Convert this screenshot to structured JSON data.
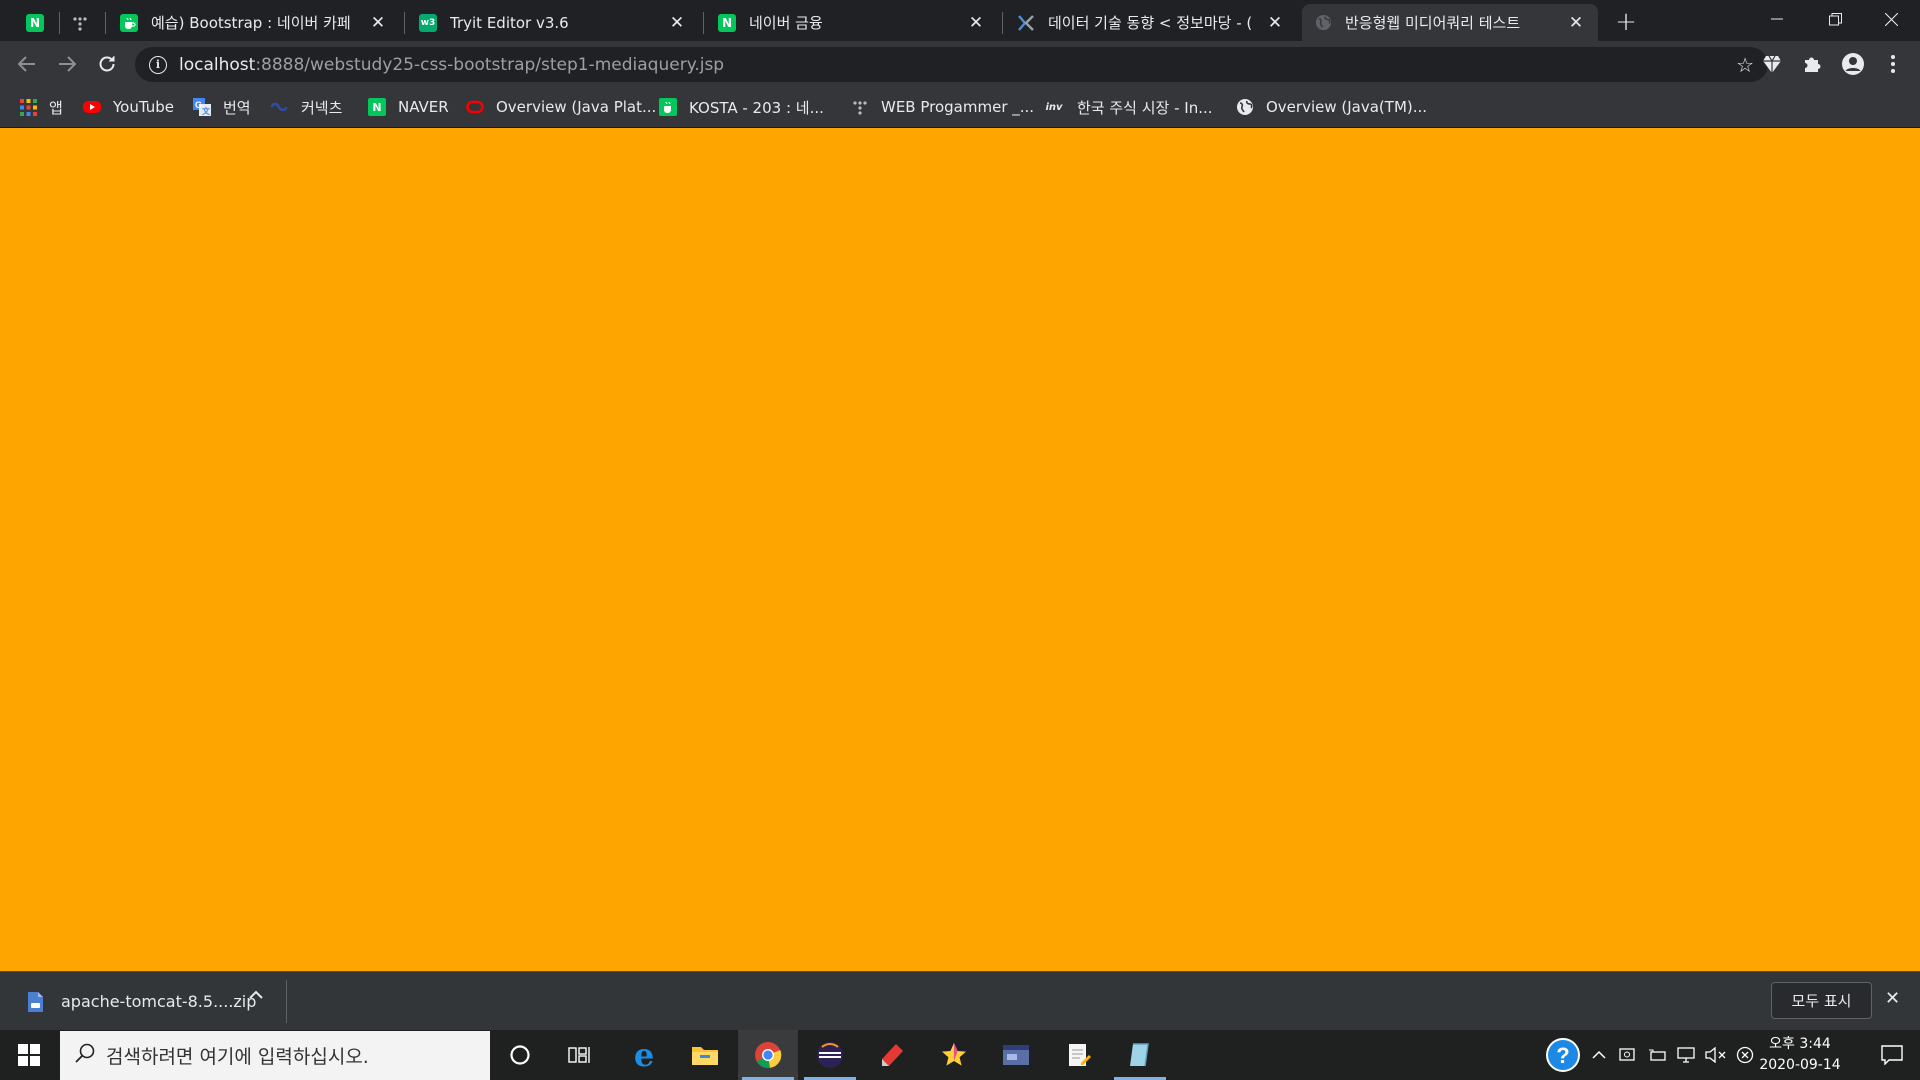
{
  "browser": {
    "tabs": [
      {
        "title": "",
        "icon": "naver-icon",
        "pinned": true
      },
      {
        "title": "",
        "icon": "dots-icon",
        "pinned": true
      },
      {
        "title": "예습) Bootstrap : 네이버 카페",
        "icon": "naver-cafe-icon"
      },
      {
        "title": "Tryit Editor v3.6",
        "icon": "w3schools-icon",
        "icon_text": "w3"
      },
      {
        "title": "네이버 금융",
        "icon": "naver-icon"
      },
      {
        "title": "데이터 기술 동향 < 정보마당 - (",
        "icon": "datatech-icon"
      },
      {
        "title": "반응형웹 미디어쿼리 테스트",
        "icon": "globe-icon",
        "active": true
      }
    ],
    "naver_letter": "N",
    "address": {
      "host": "localhost",
      "path": ":8888/webstudy25-css-bootstrap/step1-mediaquery.jsp"
    },
    "bookmarks": [
      {
        "label": "앱",
        "icon": "apps-grid-icon"
      },
      {
        "label": "YouTube",
        "icon": "youtube-icon"
      },
      {
        "label": "번역",
        "icon": "google-translate-icon"
      },
      {
        "label": "커넥츠",
        "icon": "connects-icon"
      },
      {
        "label": "NAVER",
        "icon": "naver-icon"
      },
      {
        "label": "Overview (Java Plat...",
        "icon": "oracle-icon"
      },
      {
        "label": "KOSTA - 203 : 네...",
        "icon": "naver-cafe-icon"
      },
      {
        "label": "WEB Progammer _...",
        "icon": "dots-icon"
      },
      {
        "label": "한국 주식 시장 - In...",
        "icon": "investing-icon",
        "icon_text": "inv"
      },
      {
        "label": "Overview (Java(TM)...",
        "icon": "globe-icon"
      }
    ]
  },
  "page": {
    "background": "#FFA500"
  },
  "downloads": {
    "filename": "apache-tomcat-8.5....zip",
    "show_all": "모두 표시"
  },
  "taskbar": {
    "search_placeholder": "검색하려면 여기에 입력하십시오.",
    "apps": [
      "cortana",
      "task-view",
      "edge",
      "file-explorer",
      "chrome",
      "eclipse",
      "app-red",
      "app-star",
      "app-blue",
      "app-notepad",
      "app-tablet"
    ],
    "time": "오후 3:44",
    "date": "2020-09-14"
  }
}
